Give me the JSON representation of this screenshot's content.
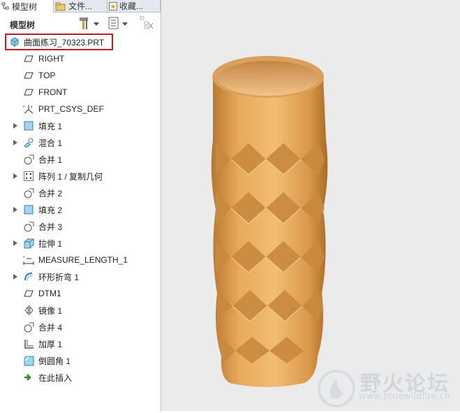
{
  "tabs": [
    {
      "label": "模型树",
      "icon": "model-tree-icon"
    },
    {
      "label": "文件...",
      "icon": "folder-icon"
    },
    {
      "label": "收藏...",
      "icon": "favorites-icon"
    }
  ],
  "toolbar": {
    "title": "模型树",
    "settings_icon": "hammer-settings-icon",
    "show_icon": "list-show-icon",
    "filter_icon": "tree-filter-icon"
  },
  "tree": {
    "root": {
      "label": "曲面练习_70323.PRT",
      "icon": "part-icon"
    },
    "items": [
      {
        "label": "RIGHT",
        "icon": "datum-plane-icon",
        "expandable": false
      },
      {
        "label": "TOP",
        "icon": "datum-plane-icon",
        "expandable": false
      },
      {
        "label": "FRONT",
        "icon": "datum-plane-icon",
        "expandable": false
      },
      {
        "label": "PRT_CSYS_DEF",
        "icon": "csys-icon",
        "expandable": false
      },
      {
        "label": "填充 1",
        "icon": "fill-icon",
        "expandable": true
      },
      {
        "label": "混合 1",
        "icon": "blend-icon",
        "expandable": true
      },
      {
        "label": "合并 1",
        "icon": "merge-icon",
        "expandable": false
      },
      {
        "label": "阵列 1 / 复制几何",
        "icon": "pattern-icon",
        "expandable": true
      },
      {
        "label": "合并 2",
        "icon": "merge-icon",
        "expandable": false
      },
      {
        "label": "填充 2",
        "icon": "fill-icon",
        "expandable": true
      },
      {
        "label": "合并 3",
        "icon": "merge-icon",
        "expandable": false
      },
      {
        "label": "拉伸 1",
        "icon": "extrude-icon",
        "expandable": true
      },
      {
        "label": "MEASURE_LENGTH_1",
        "icon": "measure-icon",
        "expandable": false
      },
      {
        "label": "环形折弯 1",
        "icon": "toroidal-bend-icon",
        "expandable": true
      },
      {
        "label": "DTM1",
        "icon": "datum-plane-icon",
        "expandable": false
      },
      {
        "label": "镜像 1",
        "icon": "mirror-icon",
        "expandable": false
      },
      {
        "label": "合并 4",
        "icon": "merge-icon",
        "expandable": false
      },
      {
        "label": "加厚 1",
        "icon": "thicken-icon",
        "expandable": false
      },
      {
        "label": "倒圆角 1",
        "icon": "round-icon",
        "expandable": false
      },
      {
        "label": "在此插入",
        "icon": "insert-here-icon",
        "expandable": false
      }
    ]
  },
  "watermark": {
    "text": "野火论坛",
    "url": "www.proewildfire.cn"
  },
  "colors": {
    "model": "#e0a054",
    "highlight": "#d0181e",
    "tree_icon": "#5aa6c8"
  }
}
